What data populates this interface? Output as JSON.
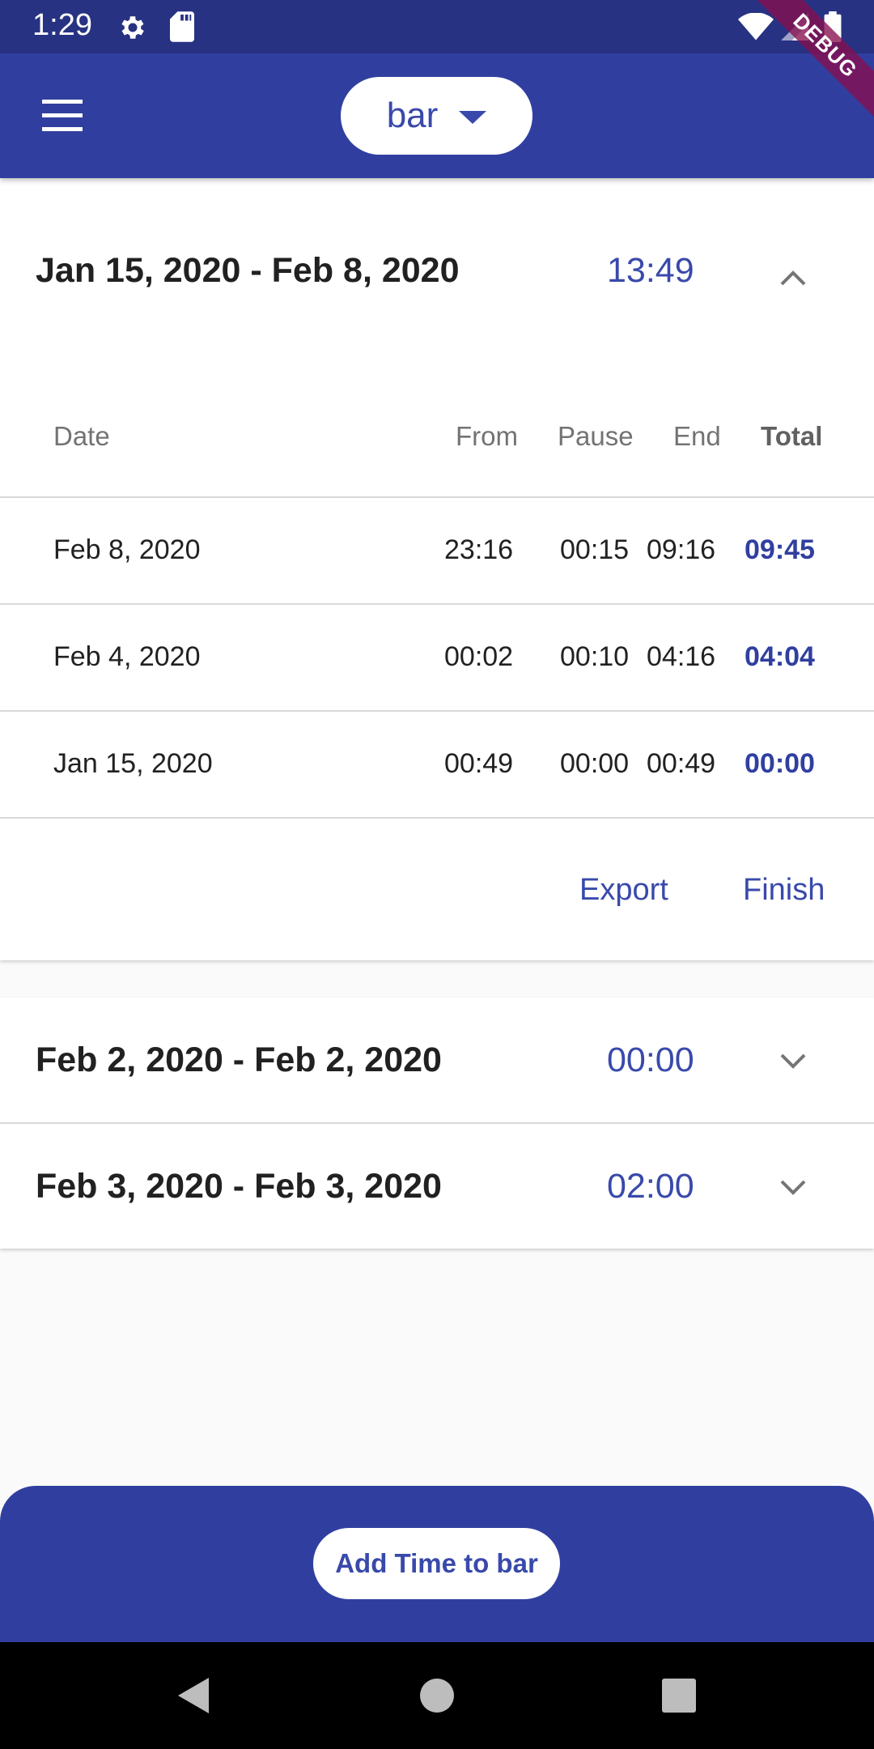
{
  "status_bar": {
    "time": "1:29",
    "icons": [
      "gear-icon",
      "sd-card-icon",
      "wifi-icon",
      "signal-icon",
      "battery-icon"
    ]
  },
  "debug_banner": "DEBUG",
  "app_bar": {
    "menu_icon": "menu-icon",
    "project_selector": "bar"
  },
  "groups": [
    {
      "range": "Jan 15, 2020 - Feb 8, 2020",
      "total": "13:49",
      "expanded": true,
      "columns": {
        "date": "Date",
        "from": "From",
        "pause": "Pause",
        "end": "End",
        "total": "Total"
      },
      "rows": [
        {
          "date": "Feb 8, 2020",
          "from": "23:16",
          "pause": "00:15",
          "end": "09:16",
          "total": "09:45"
        },
        {
          "date": "Feb 4, 2020",
          "from": "00:02",
          "pause": "00:10",
          "end": "04:16",
          "total": "04:04"
        },
        {
          "date": "Jan 15, 2020",
          "from": "00:49",
          "pause": "00:00",
          "end": "00:49",
          "total": "00:00"
        }
      ],
      "actions": {
        "export": "Export",
        "finish": "Finish"
      }
    },
    {
      "range": "Feb 2, 2020 - Feb 2, 2020",
      "total": "00:00",
      "expanded": false
    },
    {
      "range": "Feb 3, 2020 - Feb 3, 2020",
      "total": "02:00",
      "expanded": false
    }
  ],
  "bottom_sheet": {
    "add_button": "Add Time to bar"
  },
  "colors": {
    "primary": "#303f9f",
    "accent_text": "#3949ab",
    "status_bar": "#283282",
    "debug": "#880e4f"
  }
}
